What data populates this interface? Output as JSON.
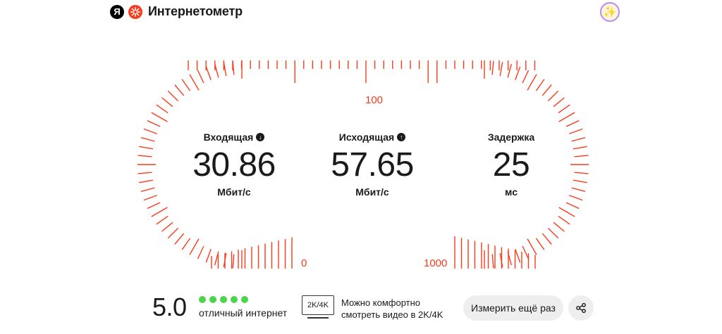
{
  "header": {
    "brand_letter": "Я",
    "title": "Интернетометр",
    "avatar_icon": "sparkles-icon",
    "avatar_glyph": "✨"
  },
  "gauge": {
    "scale_labels": {
      "min": "0",
      "mid": "100",
      "max": "1000"
    },
    "color": "#fa3a1a"
  },
  "metrics": {
    "download": {
      "title": "Входящая",
      "value": "30.86",
      "unit": "Мбит/с",
      "icon": "arrow-down-icon",
      "glyph": "↓"
    },
    "upload": {
      "title": "Исходящая",
      "value": "57.65",
      "unit": "Мбит/с",
      "icon": "arrow-up-icon",
      "glyph": "↑"
    },
    "latency": {
      "title": "Задержка",
      "value": "25",
      "unit": "мс"
    }
  },
  "rating": {
    "value": "5.0",
    "stars": 5,
    "label": "отличный интернет",
    "dot_color": "#4cd44c"
  },
  "video": {
    "badge": "2K/4K",
    "text": "Можно комфортно смотреть видео в 2K/4K"
  },
  "actions": {
    "remeasure_label": "Измерить ещё раз",
    "share_icon": "share-icon"
  }
}
